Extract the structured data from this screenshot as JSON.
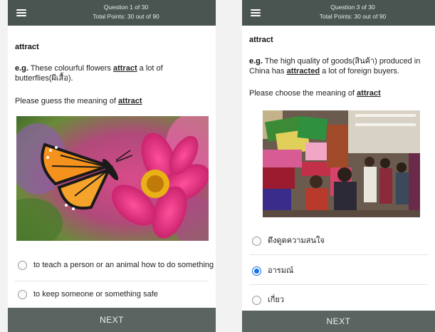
{
  "screen1": {
    "header": {
      "question": "Question 1 of 30",
      "points": "Total Points: 30 out of 90"
    },
    "word": "attract",
    "example": {
      "prefix": "e.g.",
      "before": " These colourful flowers ",
      "highlight": "attract",
      "after": " a lot of butterflies(ผีเสื้อ)."
    },
    "prompt": {
      "text": "Please guess the meaning of ",
      "word": "attract"
    },
    "options": [
      "to teach a person or an animal how to do something",
      "to keep someone or something safe"
    ],
    "next_label": "NEXT"
  },
  "screen2": {
    "header": {
      "question": "Question 3 of 30",
      "points": "Total Points: 30 out of 90"
    },
    "word": "attract",
    "example": {
      "prefix": "e.g.",
      "before": " The high quality of goods(สินค้า) produced in China has ",
      "highlight": "attracted",
      "after": " a lot of foreign buyers."
    },
    "prompt": {
      "text": "Please choose the meaning of ",
      "word": "attract"
    },
    "options": [
      {
        "label": "ดึงดูดความสนใจ",
        "selected": false
      },
      {
        "label": "อารมณ์",
        "selected": true
      },
      {
        "label": "เกี่ยว",
        "selected": false
      }
    ],
    "next_label": "NEXT"
  },
  "colors": {
    "header": "#4a5551",
    "next_button": "#5b6460",
    "radio_selected": "#1a73e8"
  }
}
